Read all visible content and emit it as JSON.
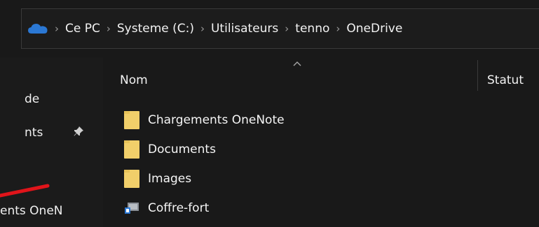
{
  "breadcrumb": {
    "items": [
      "Ce PC",
      "Systeme (C:)",
      "Utilisateurs",
      "tenno",
      "OneDrive"
    ],
    "separator": "›"
  },
  "sidebar": {
    "items": [
      {
        "label": "de"
      },
      {
        "label": "nts"
      },
      {
        "label": "ents OneN"
      }
    ]
  },
  "columns": {
    "name": "Nom",
    "status": "Statut"
  },
  "files": [
    {
      "name": "Chargements OneNote",
      "icon": "folder-icon"
    },
    {
      "name": "Documents",
      "icon": "folder-icon"
    },
    {
      "name": "Images",
      "icon": "folder-icon"
    },
    {
      "name": "Coffre-fort",
      "icon": "vault-icon"
    }
  ],
  "colors": {
    "folder": "#f1cf6a",
    "onedrive": "#2b78d4",
    "annotation": "#e0141a"
  }
}
